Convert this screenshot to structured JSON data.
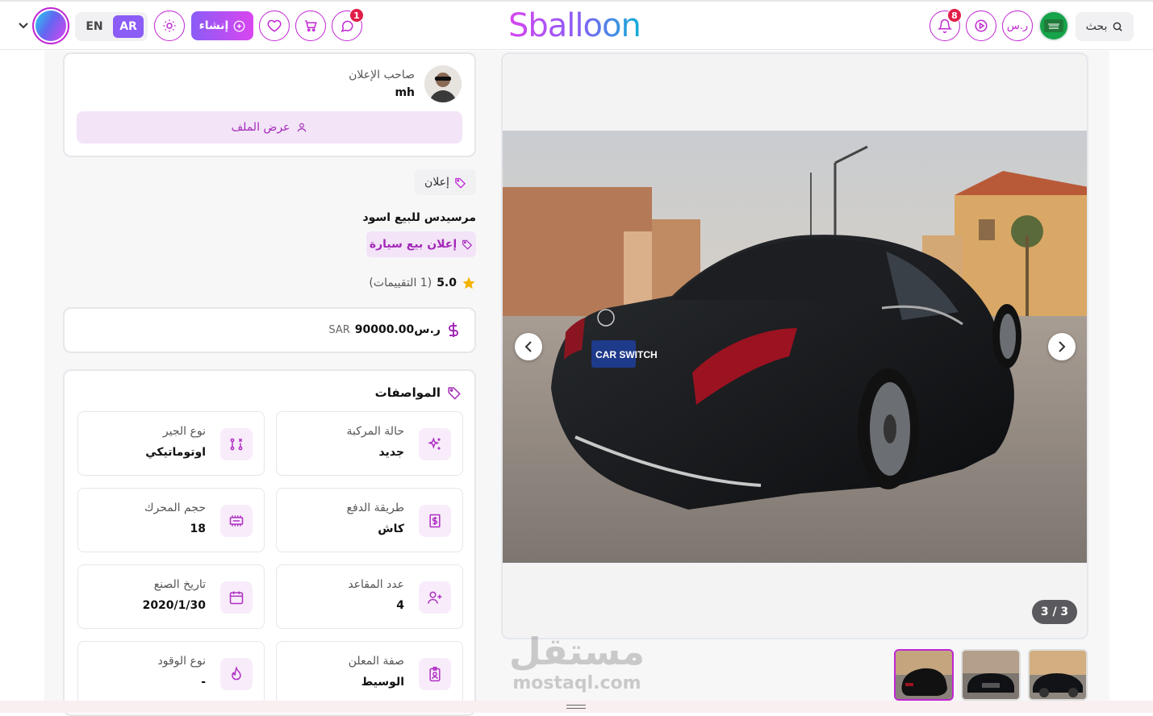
{
  "header": {
    "logo": "Sballoon",
    "search_label": "بحث",
    "currency_label": "ر.س",
    "notifications_count": "8",
    "messages_count": "1",
    "create_label": "إنشاء",
    "lang_ar": "AR",
    "lang_en": "EN"
  },
  "owner": {
    "title": "صاحب الإعلان",
    "name": "mh",
    "view_profile": "عرض الملف"
  },
  "ad": {
    "tag": "إعلان",
    "title": "مرسيدس للبيع اسود",
    "category": "إعلان بيع سيارة",
    "rating": "5.0",
    "ratings_count": "(1 التقييمات)",
    "price_prefix": "ر.س",
    "price_value": "90000.00",
    "currency": "SAR"
  },
  "specs": {
    "title": "المواصفات",
    "items": [
      {
        "label": "حالة المركبة",
        "value": "جديد",
        "icon": "sparkles-icon"
      },
      {
        "label": "نوع الجير",
        "value": "اوتوماتيكي",
        "icon": "gear-shift-icon"
      },
      {
        "label": "طريقة الدفع",
        "value": "كاش",
        "icon": "dollar-bill-icon"
      },
      {
        "label": "حجم المحرك",
        "value": "18",
        "icon": "engine-icon"
      },
      {
        "label": "عدد المقاعد",
        "value": "4",
        "icon": "user-plus-icon"
      },
      {
        "label": "تاريخ الصنع",
        "value": "2020/1/30",
        "icon": "calendar-icon"
      },
      {
        "label": "صفة المعلن",
        "value": "الوسيط",
        "icon": "id-badge-icon"
      },
      {
        "label": "نوع الوقود",
        "value": "-",
        "icon": "flame-icon"
      }
    ]
  },
  "gallery": {
    "counter": "3 / 3",
    "car_plate_text": "CAR SWITCH"
  },
  "watermark": {
    "arabic": "مستقل",
    "latin": "mostaql.com"
  },
  "colors": {
    "accent": "#c026d3",
    "accent_light": "#f3e4f8",
    "star": "#f5b301"
  }
}
